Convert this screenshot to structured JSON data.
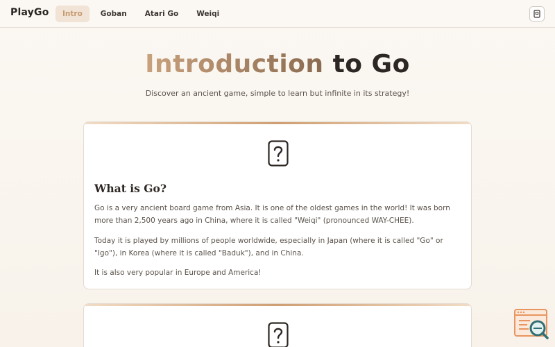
{
  "brand": "PlayGo",
  "nav": [
    {
      "label": "Intro",
      "active": true
    },
    {
      "label": "Goban",
      "active": false
    },
    {
      "label": "Atari Go",
      "active": false
    },
    {
      "label": "Weiqi",
      "active": false
    }
  ],
  "hero": {
    "title_part1": "Introduction",
    "title_part2": "to Go",
    "subtitle": "Discover an ancient game, simple to learn but infinite in its strategy!"
  },
  "cards": [
    {
      "icon": "question-card-icon",
      "title": "What is Go?",
      "paragraphs": [
        "Go is a very ancient board game from Asia. It is one of the oldest games in the world! It was born more than 2,500 years ago in China, where it is called \"Weiqi\" (pronounced WAY-CHEE).",
        "Today it is played by millions of people worldwide, especially in Japan (where it is called \"Go\" or \"Igo\"), in Korea (where it is called \"Baduk\"), and in China.",
        "It is also very popular in Europe and America!"
      ]
    },
    {
      "icon": "question-card-icon"
    }
  ],
  "colors": {
    "accent": "#c79a70",
    "accent_dark": "#8a6a50",
    "text": "#2d2723",
    "muted": "#5a524b",
    "card_border": "#e3dbd1"
  },
  "icons": {
    "mode_button": "card-icon",
    "floating_widget": "browser-search-icon"
  }
}
